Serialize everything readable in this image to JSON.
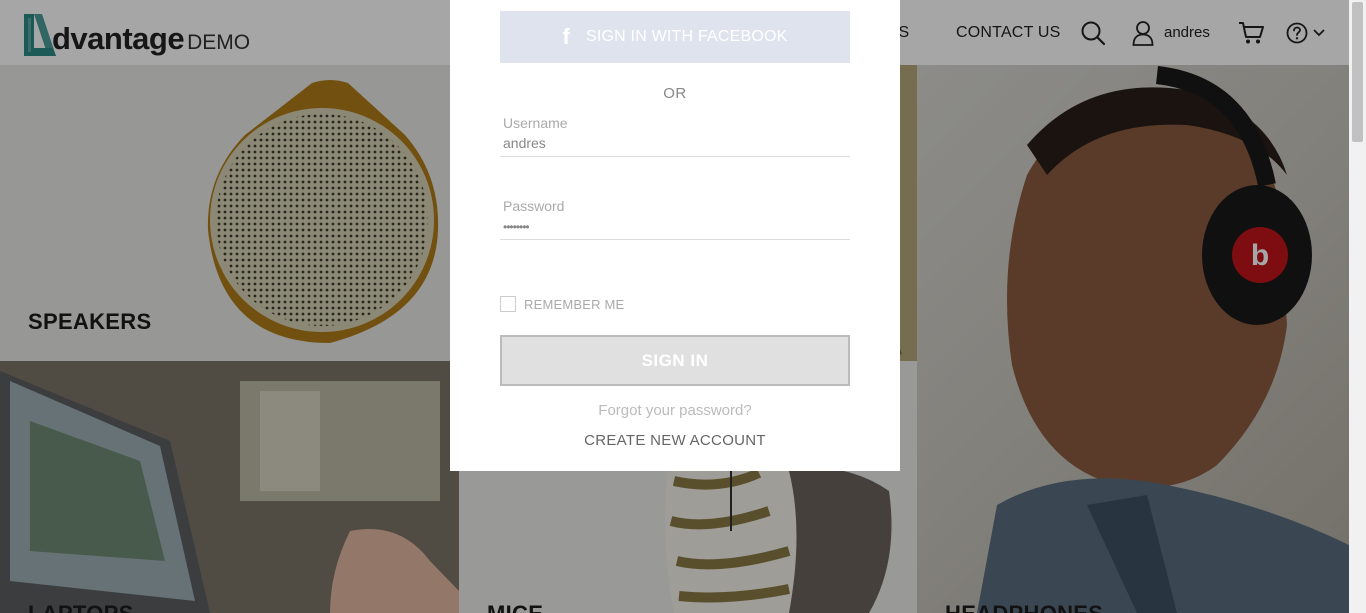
{
  "header": {
    "logo_word": "dvantage",
    "logo_demo": "DEMO",
    "nav_partial": "MS",
    "nav_contact": "CONTACT US",
    "username": "andres",
    "icons": [
      "search-icon",
      "user-icon",
      "cart-icon",
      "help-icon",
      "chevron-down-icon"
    ]
  },
  "categories": {
    "speakers": "SPEAKERS",
    "laptops": "LAPTOPS",
    "mice": "MICE",
    "headphones": "HEADPHONES"
  },
  "login": {
    "facebook_label": "SIGN IN WITH FACEBOOK",
    "or_label": "OR",
    "username_label": "Username",
    "username_value": "andres",
    "password_label": "Password",
    "password_value": "••••••••",
    "remember_label": "REMEMBER ME",
    "signin_label": "SIGN IN",
    "forgot_label": "Forgot your password?",
    "create_label": "CREATE NEW ACCOUNT"
  },
  "colors": {
    "brand": "#2a8a86",
    "facebook_button": "#dfe3ee",
    "overlay": "rgba(0,0,0,0.35)"
  }
}
